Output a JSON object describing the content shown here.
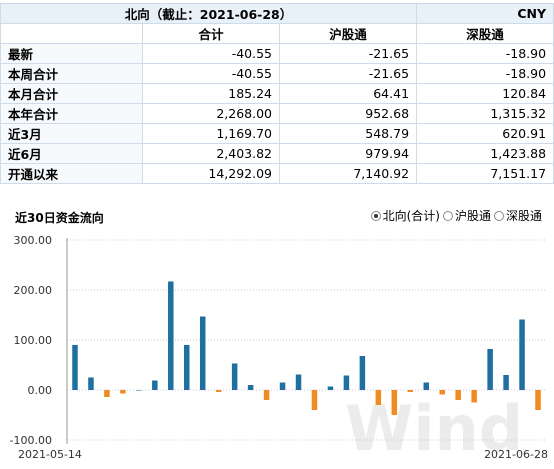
{
  "header": {
    "title": "北向（截止：2021-06-28）",
    "currency": "CNY"
  },
  "table": {
    "columns": [
      "合计",
      "沪股通",
      "深股通"
    ],
    "rows": [
      {
        "label": "最新",
        "values": [
          "-40.55",
          "-21.65",
          "-18.90"
        ]
      },
      {
        "label": "本周合计",
        "values": [
          "-40.55",
          "-21.65",
          "-18.90"
        ]
      },
      {
        "label": "本月合计",
        "values": [
          "185.24",
          "64.41",
          "120.84"
        ]
      },
      {
        "label": "本年合计",
        "values": [
          "2,268.00",
          "952.68",
          "1,315.32"
        ]
      },
      {
        "label": "近3月",
        "values": [
          "1,169.70",
          "548.79",
          "620.91"
        ]
      },
      {
        "label": "近6月",
        "values": [
          "2,403.82",
          "979.94",
          "1,423.88"
        ]
      },
      {
        "label": "开通以来",
        "values": [
          "14,292.09",
          "7,140.92",
          "7,151.17"
        ]
      }
    ]
  },
  "chart_header": {
    "title": "近30日资金流向",
    "options": [
      {
        "label": "北向(合计)",
        "selected": true
      },
      {
        "label": "沪股通",
        "selected": false
      },
      {
        "label": "深股通",
        "selected": false
      }
    ]
  },
  "colors": {
    "positive": "#1f6fa0",
    "negative": "#f08a22",
    "grid": "#c9c9c9"
  },
  "chart_data": {
    "type": "bar",
    "yticks": [
      "300.00",
      "200.00",
      "100.00",
      "0.00",
      "-100.00"
    ],
    "ylim": [
      -100,
      300
    ],
    "grid": true,
    "x_start_label": "2021-05-14",
    "x_end_label": "2021-06-28",
    "values": [
      90,
      25,
      -14,
      -7,
      0,
      19,
      217,
      90,
      147,
      -4,
      53,
      10,
      -20,
      15,
      31,
      -40,
      7,
      29,
      68,
      -30,
      -50,
      -4,
      15,
      -9,
      -20,
      -25,
      82,
      30,
      141,
      -40
    ],
    "watermark": "Wind"
  }
}
